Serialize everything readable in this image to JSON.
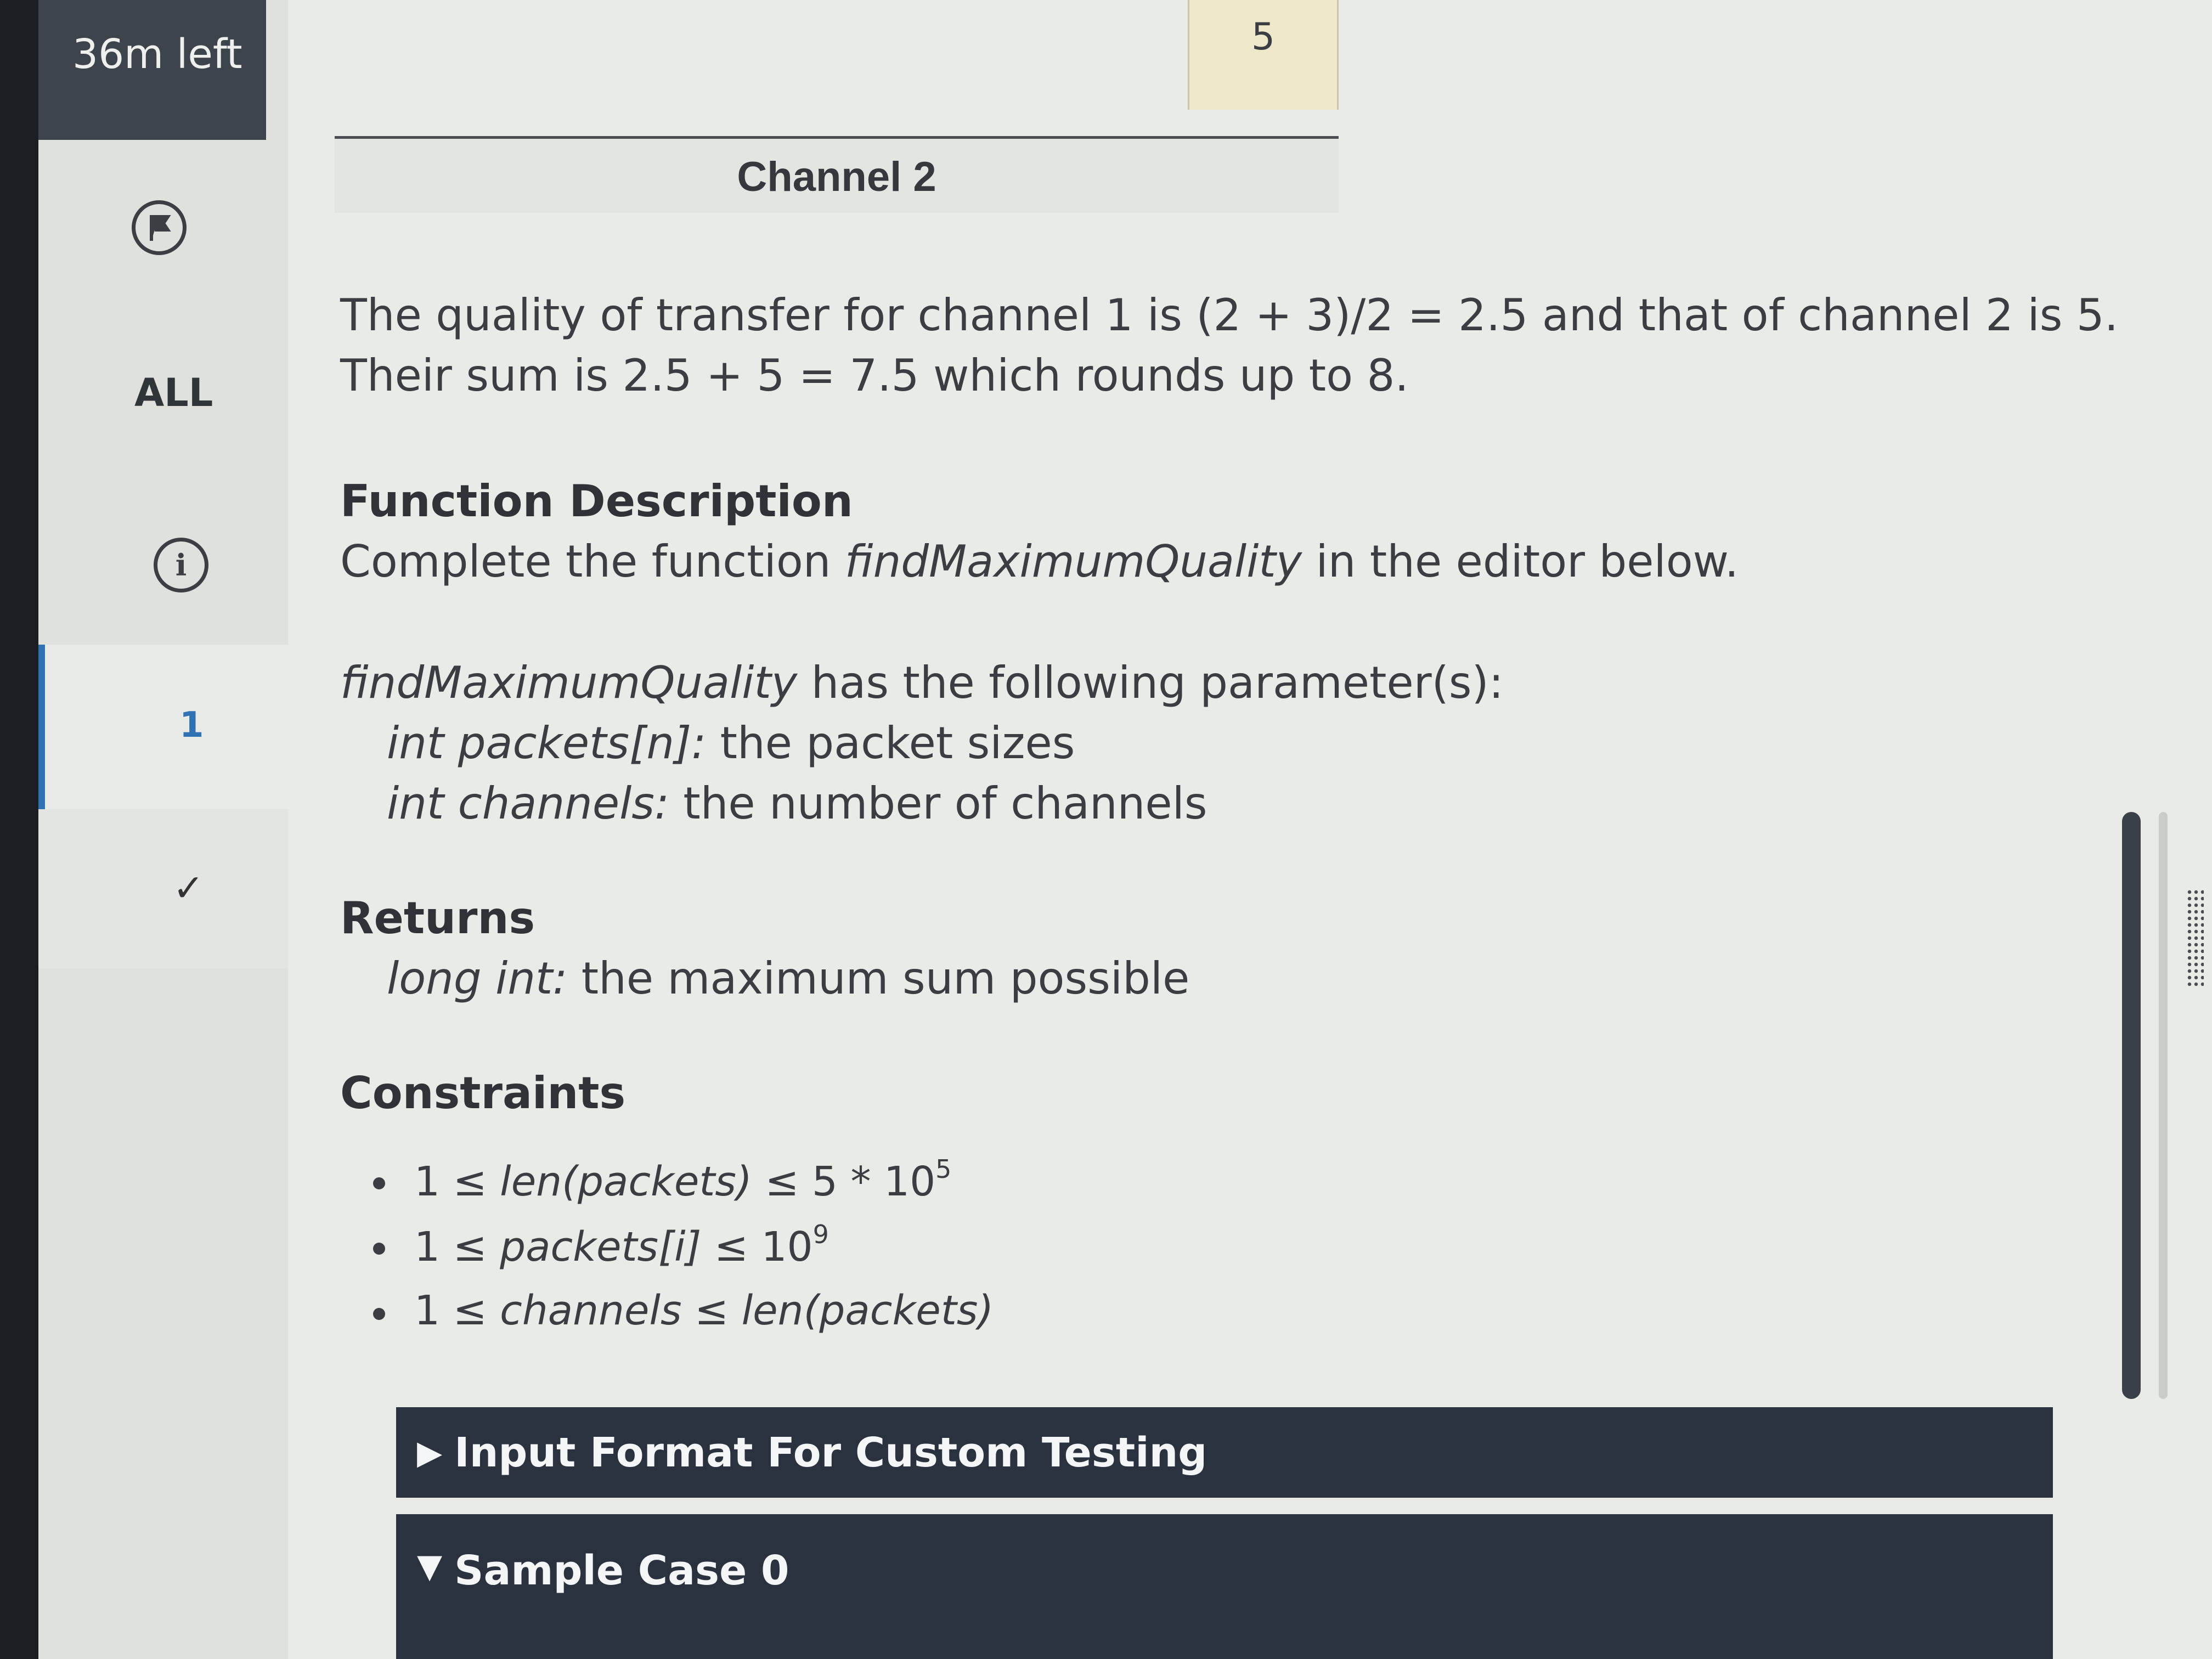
{
  "sidebar": {
    "timer": "36m left",
    "all_label": "ALL",
    "question_number": "1",
    "nav_icon": "flag-icon",
    "info_icon": "info-icon",
    "check_icon": "check-icon"
  },
  "table": {
    "value_cell": "5",
    "header": "Channel 2"
  },
  "content": {
    "explanation": "The quality of transfer for channel 1 is (2 + 3)/2 = 2.5 and that of channel 2 is 5. Their sum is 2.5 + 5 = 7.5 which rounds up to 8.",
    "function_description": {
      "heading": "Function Description",
      "text_prefix": "Complete the function ",
      "function_name": "findMaximumQuality",
      "text_suffix": " in the editor below."
    },
    "parameters": {
      "function_name": "findMaximumQuality",
      "intro": " has the following parameter(s):",
      "items": [
        {
          "name": "int packets[n]:",
          "desc": " the packet sizes"
        },
        {
          "name": "int channels:",
          "desc": " the number of channels"
        }
      ]
    },
    "returns": {
      "heading": "Returns",
      "type": "long int:",
      "desc": " the maximum sum possible"
    },
    "constraints": {
      "heading": "Constraints",
      "items": [
        {
          "pre": "1 ≤ ",
          "expr": "len(packets)",
          "post": " ≤ 5 * 10",
          "sup": "5"
        },
        {
          "pre": "1 ≤ ",
          "expr": "packets[i]",
          "post": " ≤ 10",
          "sup": "9"
        },
        {
          "pre": "1 ≤ ",
          "expr": "channels",
          "post": " ≤ ",
          "expr2": "len(packets)"
        }
      ]
    }
  },
  "bars": {
    "input_format": "Input Format For Custom Testing",
    "input_format_arrow": "▶",
    "sample_case": "Sample Case 0",
    "sample_case_arrow": "▼"
  }
}
